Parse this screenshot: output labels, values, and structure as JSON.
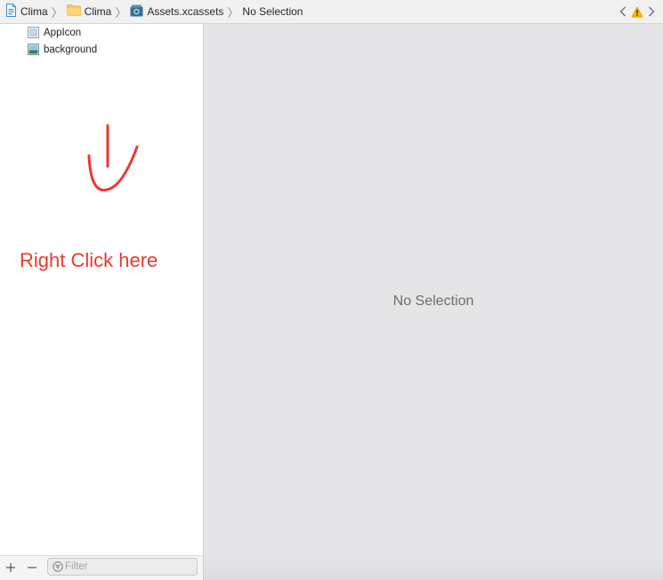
{
  "jumpbar": {
    "crumbs": [
      {
        "label": "Clima",
        "icon": "project-file-icon"
      },
      {
        "label": "Clima",
        "icon": "folder-icon"
      },
      {
        "label": "Assets.xcassets",
        "icon": "asset-catalog-icon"
      },
      {
        "label": "No Selection",
        "icon": ""
      }
    ],
    "separator": "〉"
  },
  "navigator": {
    "items": [
      {
        "label": "AppIcon",
        "icon": "app-icon-set-icon"
      },
      {
        "label": "background",
        "icon": "image-set-icon"
      }
    ],
    "annotation": "Right Click here",
    "annotation_color": "#e83a30"
  },
  "editor": {
    "empty_label": "No Selection"
  },
  "bottom_bar": {
    "add": "+",
    "remove": "—",
    "filter_placeholder": "Filter",
    "filter_value": ""
  },
  "colors": {
    "warning": "#f5b800",
    "folder": "#f6c75a",
    "editor_bg": "#e5e5e8"
  }
}
